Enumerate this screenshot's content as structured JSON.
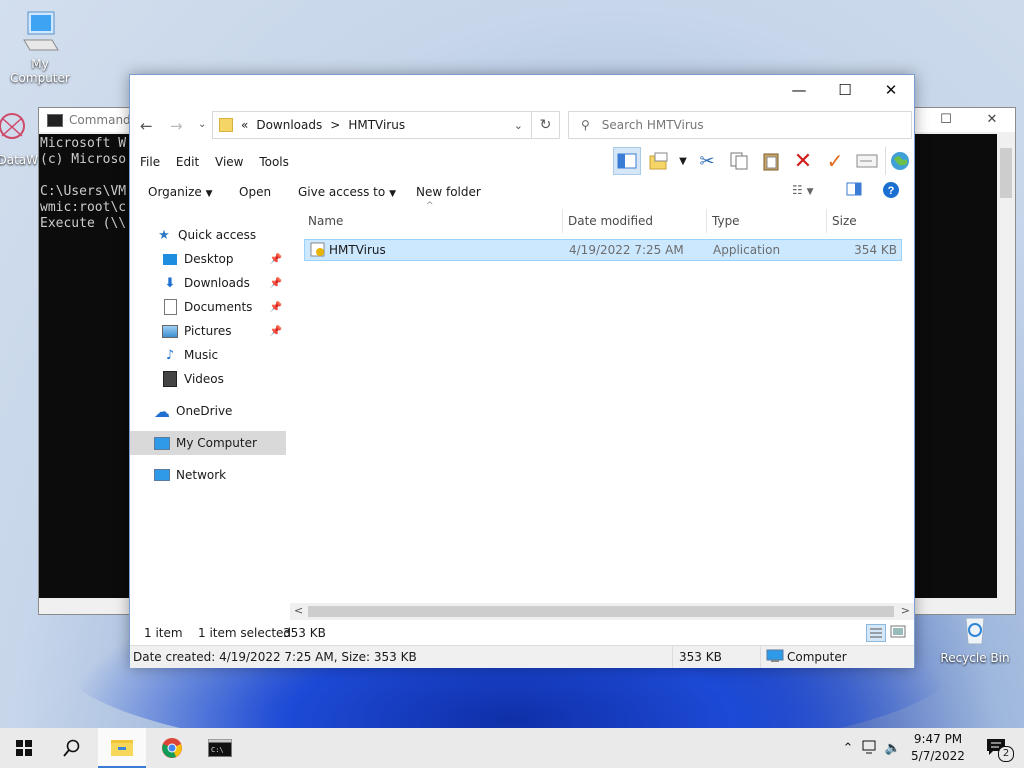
{
  "desktop": {
    "icons": [
      {
        "label": "My Computer",
        "icon": "computer-icon"
      },
      {
        "label": "DataW",
        "icon": "dataw-icon"
      },
      {
        "label": "Recycle Bin",
        "icon": "recycle-bin-icon"
      }
    ]
  },
  "cmd_window": {
    "title": "Command",
    "lines": [
      "Microsoft W",
      "(c) Microso",
      "",
      "C:\\Users\\VM",
      "wmic:root\\c",
      "Execute (\\\\"
    ]
  },
  "explorer": {
    "caption": {
      "minimize": "—",
      "maximize": "☐",
      "close": "✕"
    },
    "address": {
      "prefix": "«",
      "crumbs": [
        "Downloads",
        "HMTVirus"
      ],
      "separator": ">"
    },
    "search_placeholder": "Search HMTVirus",
    "menu": [
      "File",
      "Edit",
      "View",
      "Tools"
    ],
    "commands": {
      "organize": "Organize",
      "open": "Open",
      "give_access": "Give access to",
      "new_folder": "New folder"
    },
    "nav": {
      "quick_access": "Quick access",
      "items": [
        {
          "label": "Desktop",
          "pinned": true
        },
        {
          "label": "Downloads",
          "pinned": true
        },
        {
          "label": "Documents",
          "pinned": true
        },
        {
          "label": "Pictures",
          "pinned": true
        },
        {
          "label": "Music",
          "pinned": false
        },
        {
          "label": "Videos",
          "pinned": false
        }
      ],
      "onedrive": "OneDrive",
      "my_computer": "My Computer",
      "network": "Network"
    },
    "columns": [
      "Name",
      "Date modified",
      "Type",
      "Size"
    ],
    "files": [
      {
        "name": "HMTVirus",
        "date": "4/19/2022 7:25 AM",
        "type": "Application",
        "size": "354 KB"
      }
    ],
    "status": {
      "count": "1 item",
      "selected": "1 item selected",
      "size": "353 KB"
    },
    "details": {
      "info": "Date created: 4/19/2022 7:25 AM, Size: 353 KB",
      "size": "353 KB",
      "location": "Computer"
    }
  },
  "taskbar": {
    "time": "9:47 PM",
    "date": "5/7/2022",
    "notifications": "2"
  },
  "colors": {
    "accent": "#0078d7",
    "selection": "#cce8ff",
    "cmd_bg": "#0c0c0c"
  }
}
